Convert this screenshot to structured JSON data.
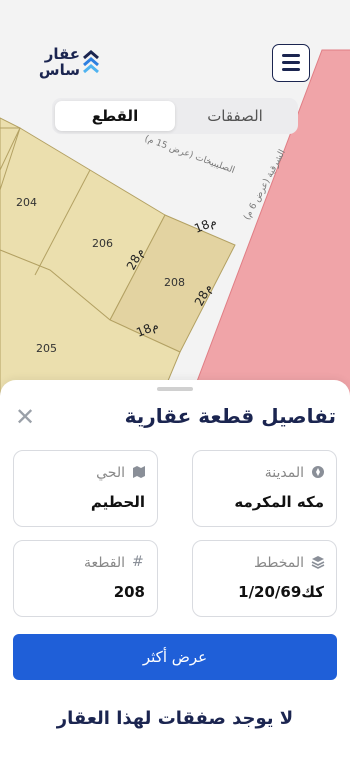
{
  "app": {
    "logo_text_line1": "عقار",
    "logo_text_line2": "ساس"
  },
  "tabs": [
    {
      "label": "القطع",
      "active": true
    },
    {
      "label": "الصفقات",
      "active": false
    }
  ],
  "map": {
    "parcels": [
      "204",
      "206",
      "208",
      "205"
    ],
    "dimensions": [
      "18م",
      "28م",
      "28م",
      "18م"
    ],
    "streets": [
      "الصليبيخات (عرض 15 م)",
      "الشرقية (عرض 6 م)"
    ],
    "colors": {
      "parcel_fill": "#ebdfae",
      "parcel_highlight": "#e3d3a1",
      "parcel_border": "#b3a163",
      "zone_pink": "#f0a4a8"
    }
  },
  "sheet": {
    "title": "تفاصيل قطعة عقارية",
    "close_icon": "close-icon",
    "fields": {
      "city": {
        "label": "المدينة",
        "value": "مكه المكرمه",
        "icon": "compass-icon"
      },
      "district": {
        "label": "الحي",
        "value": "الحطيم",
        "icon": "map-icon"
      },
      "plan": {
        "label": "المخطط",
        "value": "كك1/20/69",
        "icon": "layers-icon"
      },
      "parcel": {
        "label": "القطعة",
        "value": "208",
        "icon": "hash-icon"
      }
    },
    "more_button": "عرض أكثر",
    "no_deals": "لا يوجد صفقات لهذا العقار",
    "accent_color": "#1f5fd8"
  }
}
